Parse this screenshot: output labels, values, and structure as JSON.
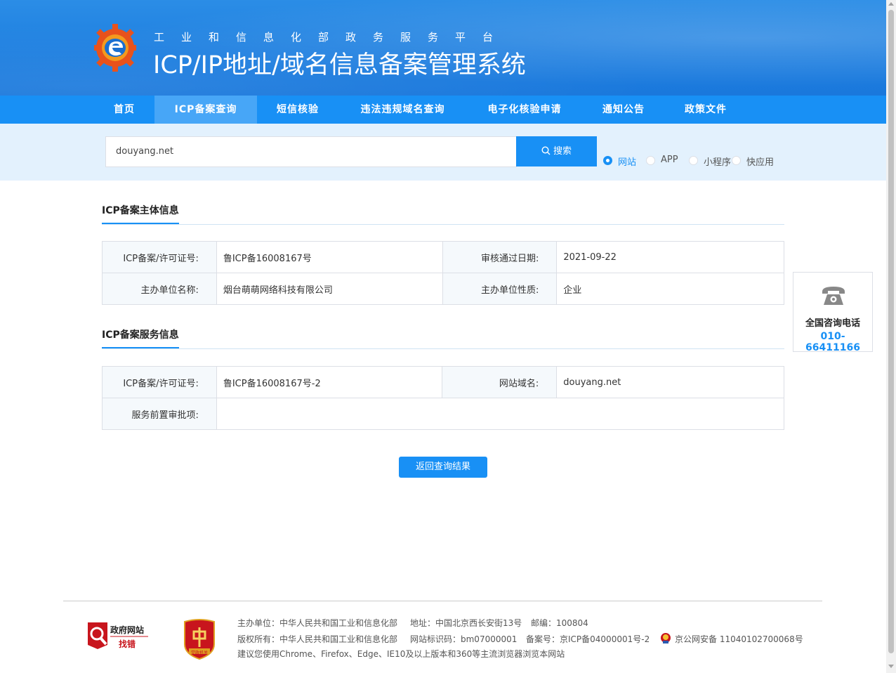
{
  "header": {
    "subtitle": "工业和信息化部政务服务平台",
    "title": "ICP/IP地址/域名信息备案管理系统"
  },
  "nav": {
    "items": [
      {
        "label": "首页",
        "active": false
      },
      {
        "label": "ICP备案查询",
        "active": true
      },
      {
        "label": "短信核验",
        "active": false
      },
      {
        "label": "违法违规域名查询",
        "active": false
      },
      {
        "label": "电子化核验申请",
        "active": false
      },
      {
        "label": "通知公告",
        "active": false
      },
      {
        "label": "政策文件",
        "active": false
      }
    ]
  },
  "search": {
    "value": "douyang.net",
    "button_label": "搜索",
    "types": [
      {
        "label": "网站",
        "checked": true
      },
      {
        "label": "APP",
        "checked": false
      },
      {
        "label": "小程序",
        "checked": false
      },
      {
        "label": "快应用",
        "checked": false
      }
    ]
  },
  "subject_info": {
    "title": "ICP备案主体信息",
    "rows": [
      {
        "k1": "ICP备案/许可证号:",
        "v1": "鲁ICP备16008167号",
        "k2": "审核通过日期:",
        "v2": "2021-09-22"
      },
      {
        "k1": "主办单位名称:",
        "v1": "烟台萌萌网络科技有限公司",
        "k2": "主办单位性质:",
        "v2": "企业"
      }
    ]
  },
  "service_info": {
    "title": "ICP备案服务信息",
    "rows": [
      {
        "k1": "ICP备案/许可证号:",
        "v1": "鲁ICP备16008167号-2",
        "k2": "网站域名:",
        "v2": "douyang.net"
      },
      {
        "k1": "服务前置审批项:",
        "v1": ""
      }
    ]
  },
  "back_button": "返回查询结果",
  "consult": {
    "label": "全国咨询电话",
    "phone": "010-66411166"
  },
  "footer": {
    "gov_badge_line1": "政府网站",
    "gov_badge_line2": "找错",
    "party_badge": "党政机关",
    "sponsor": "主办单位：中华人民共和国工业和信息化部",
    "address": "地址：中国北京西长安街13号",
    "postcode": "邮编：100804",
    "copyright": "版权所有：中华人民共和国工业和信息化部",
    "site_code": "网站标识码：bm07000001",
    "icp": "备案号：京ICP备04000001号-2",
    "police": "京公网安备 11040102700068号",
    "browser_tip": "建议您使用Chrome、Firefox、Edge、IE10及以上版本和360等主流浏览器浏览本网站"
  },
  "colors": {
    "primary": "#1890f5",
    "header_bg": "#1e7fe0",
    "search_band": "#e3f1fd"
  }
}
